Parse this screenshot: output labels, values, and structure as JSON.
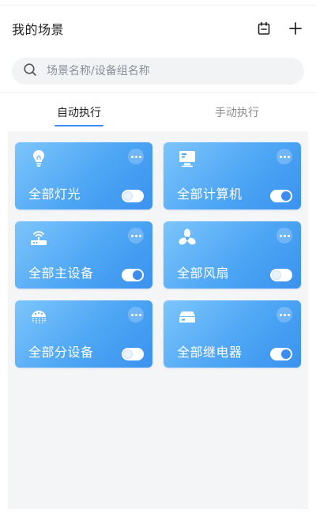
{
  "header": {
    "title": "我的场景",
    "calendar_icon": "calendar-icon",
    "add_icon": "plus-icon"
  },
  "search": {
    "placeholder": "场景名称/设备组名称",
    "value": "",
    "icon": "search-icon"
  },
  "tabs": [
    {
      "label": "自动执行",
      "active": true
    },
    {
      "label": "手动执行",
      "active": false
    }
  ],
  "colors": {
    "accent": "#3b8cf7",
    "card_gradient_start": "#7cc5fb",
    "card_gradient_end": "#3a92ee"
  },
  "cards": [
    {
      "label": "全部灯光",
      "icon": "lightbulb-icon",
      "enabled": false
    },
    {
      "label": "全部计算机",
      "icon": "monitor-icon",
      "enabled": true
    },
    {
      "label": "全部主设备",
      "icon": "router-icon",
      "enabled": true
    },
    {
      "label": "全部风扇",
      "icon": "fan-icon",
      "enabled": false
    },
    {
      "label": "全部分设备",
      "icon": "jellyfish-device-icon",
      "enabled": false
    },
    {
      "label": "全部继电器",
      "icon": "relay-icon",
      "enabled": true
    }
  ]
}
